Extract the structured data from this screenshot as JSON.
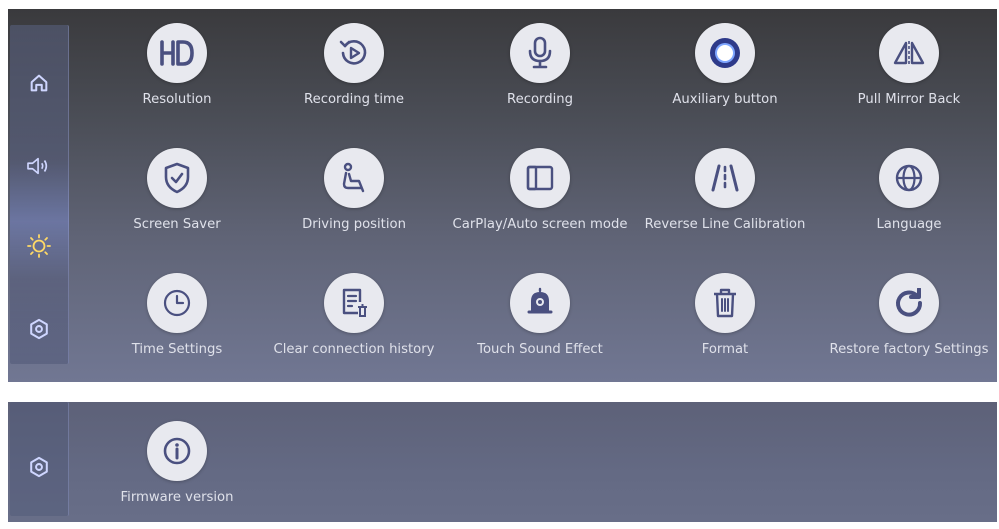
{
  "colors": {
    "icon_fill": "#4a5080",
    "circle_bg": "#e8e9ef",
    "label_text": "#dfe1ea",
    "sidebar_icon": "#cfd6ff"
  },
  "sidebar": {
    "items": [
      {
        "icon": "home-icon"
      },
      {
        "icon": "volume-icon"
      },
      {
        "icon": "brightness-icon"
      },
      {
        "icon": "settings-icon"
      }
    ]
  },
  "settings": {
    "items": [
      {
        "icon": "hd-icon",
        "label": "Resolution"
      },
      {
        "icon": "replay-icon",
        "label": "Recording time"
      },
      {
        "icon": "microphone-icon",
        "label": "Recording"
      },
      {
        "icon": "dot-icon",
        "label": "Auxiliary button"
      },
      {
        "icon": "mirror-icon",
        "label": "Pull Mirror Back"
      },
      {
        "icon": "shield-icon",
        "label": "Screen Saver"
      },
      {
        "icon": "seat-icon",
        "label": "Driving position"
      },
      {
        "icon": "split-screen-icon",
        "label": "CarPlay/Auto screen mode"
      },
      {
        "icon": "reverse-line-icon",
        "label": "Reverse Line Calibration"
      },
      {
        "icon": "globe-icon",
        "label": "Language"
      },
      {
        "icon": "clock-icon",
        "label": "Time Settings"
      },
      {
        "icon": "clear-history-icon",
        "label": "Clear connection history"
      },
      {
        "icon": "bell-icon",
        "label": "Touch Sound Effect"
      },
      {
        "icon": "trash-icon",
        "label": "Format"
      },
      {
        "icon": "restore-icon",
        "label": "Restore factory Settings"
      }
    ]
  },
  "page2": {
    "sidebar_icon": "settings-icon",
    "items": [
      {
        "icon": "info-icon",
        "label": "Firmware version"
      }
    ]
  }
}
